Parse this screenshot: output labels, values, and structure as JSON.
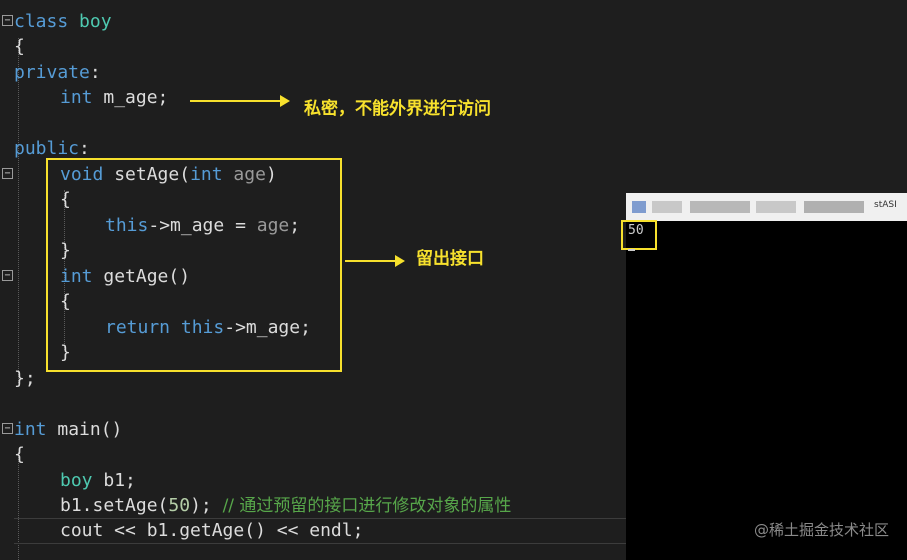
{
  "code": {
    "class_kw": "class",
    "class_name": "boy",
    "open_brace": "{",
    "private_kw": "private",
    "colon": ":",
    "int_kw": "int",
    "m_age_decl": " m_age;",
    "public_kw": "public",
    "void_kw": "void",
    "set_age_sig": " setAge(",
    "param_age": "age",
    "close_paren": ")",
    "this_kw": "this",
    "arrow_op": "->",
    "m_age_assign": "m_age = ",
    "semicolon": ";",
    "close_brace": "}",
    "get_age_sig": " getAge()",
    "return_kw": "return",
    "m_age_return": "m_age;",
    "class_end": "};",
    "main_sig": " main()",
    "boy_b1": " b1;",
    "set_call_pre": "b1.setAge(",
    "set_call_arg": "50",
    "set_call_post": "); ",
    "comment": "// 通过预留的接口进行修改对象的属性",
    "cout_line": "cout << b1.getAge() << endl;"
  },
  "annotations": {
    "private_note": "私密，不能外界进行访问",
    "interface_note": "留出接口"
  },
  "console": {
    "title_fragment": "stASI",
    "output": "50"
  },
  "watermark": "@稀土掘金技术社区",
  "colors": {
    "background": "#1e1e1e",
    "keyword": "#569cd6",
    "type": "#4ec9b0",
    "comment": "#57a64a",
    "highlight": "#f7e12d"
  }
}
